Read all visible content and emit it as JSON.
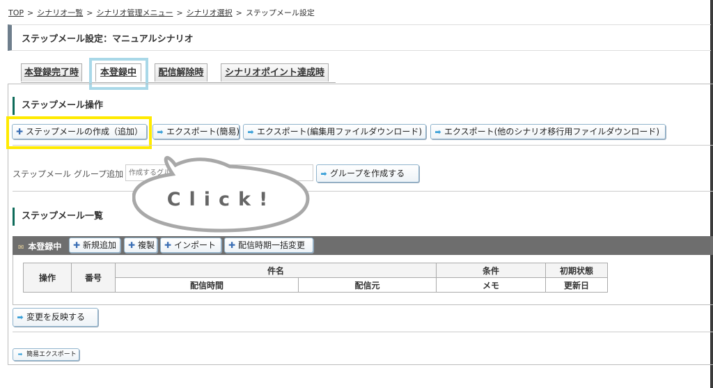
{
  "breadcrumb": {
    "items": [
      "TOP",
      "シナリオ一覧",
      "シナリオ管理メニュー",
      "シナリオ選択"
    ],
    "current": "ステップメール設定",
    "sep": ">"
  },
  "page": {
    "title": "ステップメール設定：マニュアルシナリオ"
  },
  "tabs": [
    "本登録完了時",
    "本登録中",
    "配信解除時",
    "シナリオポイント達成時"
  ],
  "ops": {
    "title": "ステップメール操作",
    "create": "ステップメールの作成（追加）",
    "export_simple": "エクスポート(簡易)",
    "export_edit": "エクスポート(編集用ファイルダウンロード)",
    "export_migrate": "エクスポート(他のシナリオ移行用ファイルダウンロード)"
  },
  "group": {
    "label": "ステップメール グループ追加",
    "placeholder": "作成するグループ名を入力してください",
    "create": "グループを作成する"
  },
  "list": {
    "title": "ステップメール一覧",
    "bar_label": "本登録中",
    "new": "新規追加",
    "copy": "複製",
    "import": "インポート",
    "bulk": "配信時期一括変更",
    "headers": {
      "op": "操作",
      "no": "番号",
      "subject": "件名",
      "cond": "条件",
      "init": "初期状態",
      "time": "配信時間",
      "from": "配信元",
      "memo": "メモ",
      "updated": "更新日"
    }
  },
  "apply": "変更を反映する",
  "simple_export": "簡易エクスポート",
  "bubble": {
    "text": "Click!"
  },
  "colors": {
    "highlight_yellow": "#ffea00",
    "highlight_blue": "#a9d8e8",
    "bar": "#6e6e6e",
    "accent": "#0e6b5a"
  }
}
